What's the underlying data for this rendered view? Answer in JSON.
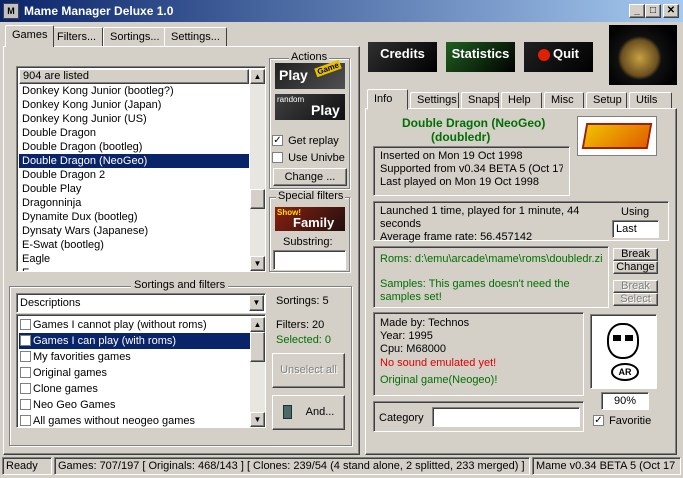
{
  "window": {
    "title": "Mame Manager Deluxe 1.0"
  },
  "main_tabs": [
    "Games",
    "Filters...",
    "Sortings...",
    "Settings..."
  ],
  "games_list": {
    "header": "904 are listed",
    "items": [
      "Donkey Kong Junior (bootleg?)",
      "Donkey Kong Junior (Japan)",
      "Donkey Kong Junior (US)",
      "Double Dragon",
      "Double Dragon (bootleg)",
      "Double Dragon (NeoGeo)",
      "Double Dragon 2",
      "Double Play",
      "Dragonninja",
      "Dynamite Dux (bootleg)",
      "Dynsaty Wars (Japanese)",
      "E-Swat (bootleg)",
      "Eagle",
      "E"
    ],
    "selected_index": 5
  },
  "actions": {
    "title": "Actions",
    "play": "Play",
    "play_sub": "Game",
    "random_play": "Play",
    "random_label": "random",
    "get_replay": "Get replay",
    "use_univbe": "Use Univbe",
    "change": "Change ...",
    "special_filters_title": "Special filters",
    "show_family": "Family",
    "show_label": "Show!",
    "substring_label": "Substring:",
    "substring_value": ""
  },
  "sortings": {
    "title": "Sortings and filters",
    "dropdown_value": "Descriptions",
    "sortings_count": "Sortings: 5",
    "filters_count": "Filters: 20",
    "selected_count": "Selected: 0",
    "unselect_all": "Unselect all",
    "and_button": "And...",
    "filter_items": [
      "Games I cannot play (without roms)",
      "Games I can play (with roms)",
      "My favorities games",
      "Original games",
      "Clone games",
      "Neo Geo Games",
      "All games without neogeo games"
    ],
    "selected_index": 1
  },
  "top_buttons": {
    "credits": "Credits",
    "statistics": "Statistics",
    "quit": "Quit"
  },
  "info_tabs": [
    "Info",
    "Settings",
    "Snaps",
    "Help",
    "Misc",
    "Setup",
    "Utils"
  ],
  "info": {
    "game_title": "Double Dragon (NeoGeo)",
    "game_id": "(doubledr)",
    "inserted": "Inserted on Mon 19 Oct 1998",
    "supported": "Supported from v0.34 BETA 5 (Oct 17",
    "last_played": "Last played on Mon 19 Oct 1998",
    "launched": "Launched 1 time, played for 1 minute, 44 seconds",
    "frame_rate": "Average frame rate: 56.457142",
    "using_label": "Using",
    "using_value": "Last",
    "roms_path": "Roms: d:\\emu\\arcade\\mame\\roms\\doubledr.zip",
    "samples_text": "Samples: This games doesn't need the samples set!",
    "break_1": "Break",
    "change_1": "Change",
    "break_2": "Break",
    "select_2": "Select",
    "made_by": "Made by: Technos",
    "year": "Year: 1995",
    "cpu": "Cpu: M68000",
    "sound": "No sound emulated yet!",
    "original": "Original game(Neogeo)!",
    "zoom": "90%",
    "favorite": "Favoritie",
    "category_label": "Category",
    "category_value": ""
  },
  "status_bar": {
    "ready": "Ready",
    "games": "Games: 707/197 [ Originals: 468/143 ] [ Clones: 239/54 (4 stand alone, 2 splitted, 233 merged) ]",
    "version": "Mame v0.34 BETA 5 (Oct 17"
  }
}
